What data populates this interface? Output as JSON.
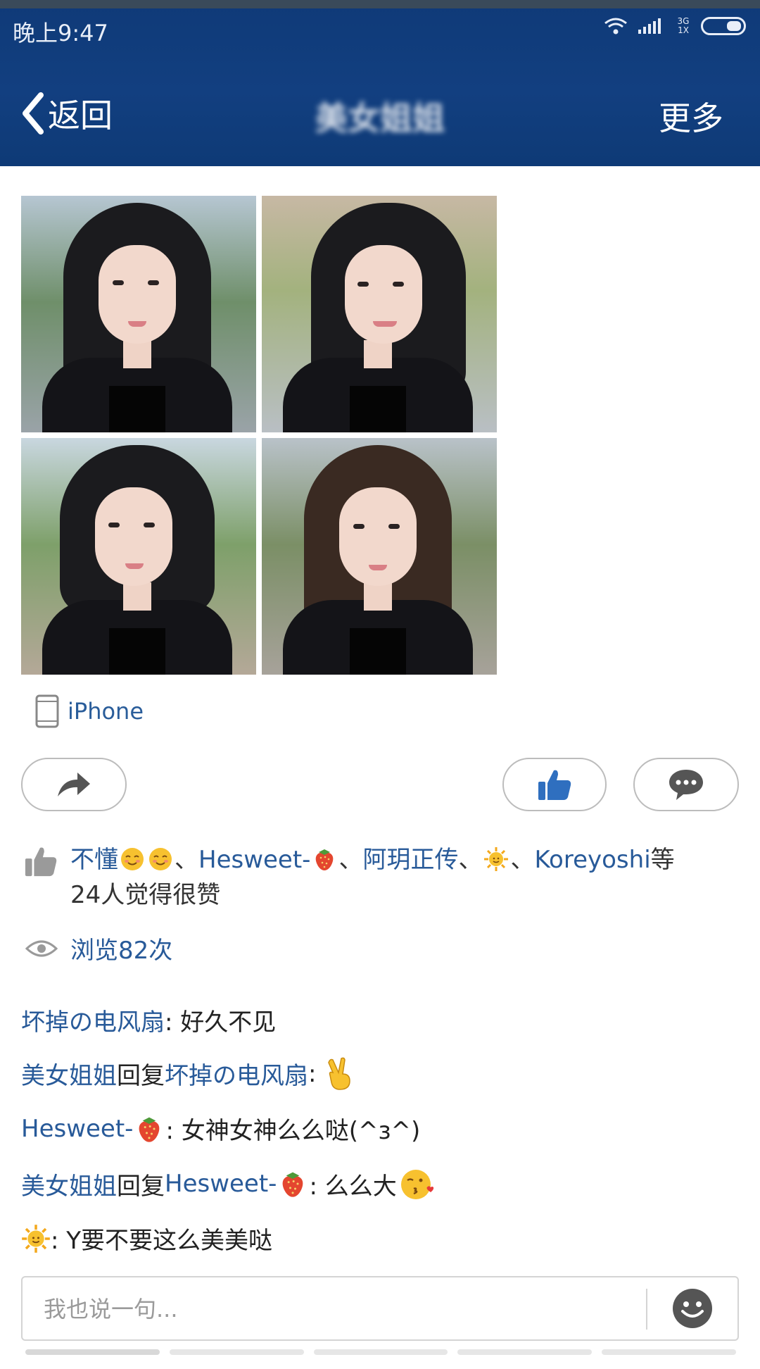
{
  "status_bar": {
    "time": "晚上9:47",
    "network": "3G 1X"
  },
  "nav": {
    "back_label": "返回",
    "title": "美女姐姐",
    "more_label": "更多"
  },
  "post": {
    "device_label": "iPhone",
    "likes": {
      "users": [
        "不懂",
        "Hesweet-",
        "阿玥正传",
        "Koreyoshi"
      ],
      "suffix_1": "等",
      "summary": "24人觉得很赞"
    },
    "views": "浏览82次"
  },
  "comments": [
    {
      "user": "坏掉の电风扇",
      "text": ": 好久不见"
    },
    {
      "user": "美女姐姐",
      "reply_word": "回复",
      "reply_to": "坏掉の电风扇",
      "text": ":"
    },
    {
      "user": "Hesweet-",
      "text": ": 女神女神么么哒(^з^)"
    },
    {
      "user": "美女姐姐",
      "reply_word": "回复",
      "reply_to": "Hesweet-",
      "text": ": 么么大"
    },
    {
      "text": ": Y要不要这么美美哒"
    }
  ],
  "input": {
    "placeholder": "我也说一句..."
  },
  "colors": {
    "header": "#123f80",
    "link": "#285a99",
    "like_blue": "#2f6fbf"
  },
  "icons": [
    "back-chevron-icon",
    "wifi-icon",
    "signal-icon",
    "battery-icon",
    "phone-device-icon",
    "share-arrow-icon",
    "thumbs-up-icon",
    "comment-bubble-icon",
    "eye-icon",
    "strawberry-emoji",
    "sun-emoji",
    "blush-emoji",
    "victory-hand-emoji",
    "kiss-emoji",
    "smiley-icon"
  ]
}
